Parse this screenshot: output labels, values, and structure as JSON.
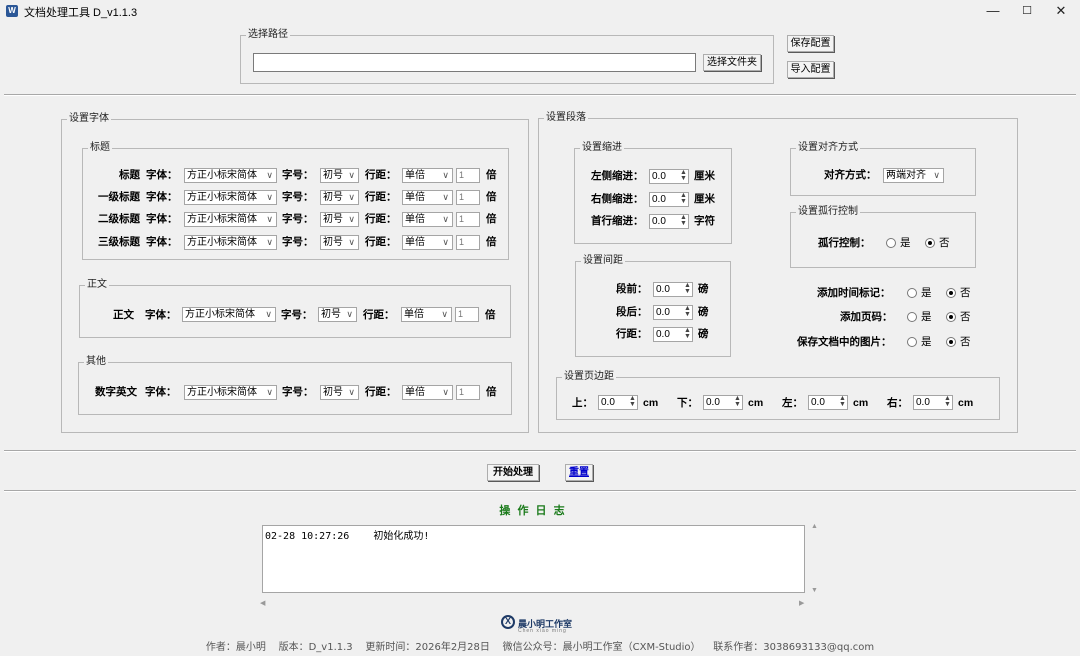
{
  "window": {
    "title": "文档处理工具 D_v1.1.3",
    "icon_letter": "W",
    "minimize": "—",
    "maximize": "☐",
    "close": "✕"
  },
  "path": {
    "group_title": "选择路径",
    "value": "",
    "browse_label": "选择文件夹"
  },
  "config": {
    "save_label": "保存配置",
    "import_label": "导入配置"
  },
  "font": {
    "group_title": "设置字体",
    "heading_group": "标题",
    "body_group": "正文",
    "other_group": "其他",
    "font_label": "字体：",
    "size_label": "字号：",
    "spacing_label": "行距：",
    "times_label": "倍",
    "rows": [
      {
        "name": "标题",
        "font": "方正小标宋简体",
        "size": "初号",
        "spacing": "单倍",
        "value": "1"
      },
      {
        "name": "一级标题",
        "font": "方正小标宋简体",
        "size": "初号",
        "spacing": "单倍",
        "value": "1"
      },
      {
        "name": "二级标题",
        "font": "方正小标宋简体",
        "size": "初号",
        "spacing": "单倍",
        "value": "1"
      },
      {
        "name": "三级标题",
        "font": "方正小标宋简体",
        "size": "初号",
        "spacing": "单倍",
        "value": "1"
      }
    ],
    "body_row": {
      "name": "正文",
      "font": "方正小标宋简体",
      "size": "初号",
      "spacing": "单倍",
      "value": "1"
    },
    "other_row": {
      "name": "数字英文",
      "font": "方正小标宋简体",
      "size": "初号",
      "spacing": "单倍",
      "value": "1"
    }
  },
  "paragraph": {
    "group_title": "设置段落",
    "indent": {
      "title": "设置缩进",
      "left_label": "左侧缩进：",
      "left_value": "0.0",
      "left_unit": "厘米",
      "right_label": "右侧缩进：",
      "right_value": "0.0",
      "right_unit": "厘米",
      "first_label": "首行缩进：",
      "first_value": "0.0",
      "first_unit": "字符"
    },
    "spacing": {
      "title": "设置间距",
      "before_label": "段前：",
      "before_value": "0.0",
      "before_unit": "磅",
      "after_label": "段后：",
      "after_value": "0.0",
      "after_unit": "磅",
      "line_label": "行距：",
      "line_value": "0.0",
      "line_unit": "磅"
    },
    "align": {
      "title": "设置对齐方式",
      "label": "对齐方式：",
      "value": "两端对齐"
    },
    "orphan": {
      "title": "设置孤行控制",
      "label": "孤行控制：",
      "yes": "是",
      "no": "否"
    },
    "timestamp_label": "添加时间标记：",
    "pagenum_label": "添加页码：",
    "keep_images_label": "保存文档中的图片：",
    "yes": "是",
    "no": "否",
    "margins": {
      "title": "设置页边距",
      "top_label": "上：",
      "top_value": "0.0",
      "bottom_label": "下：",
      "bottom_value": "0.0",
      "left_label": "左：",
      "left_value": "0.0",
      "right_label": "右：",
      "right_value": "0.0",
      "unit": "cm"
    }
  },
  "actions": {
    "start_label": "开始处理",
    "reset_label": "重置"
  },
  "log": {
    "title": "操 作 日 志",
    "entries": "02-28 10:27:26    初始化成功!"
  },
  "brand": {
    "name": "晨小明工作室",
    "pinyin": "Chen xiao ming"
  },
  "footer": "作者：晨小明    版本：D_v1.1.3    更新时间：2026年2月28日    微信公众号：晨小明工作室（CXM-Studio）    联系作者：3038693133@qq.com",
  "colors": {
    "log_title": "#1a7a1a",
    "reset_link": "#0000cc",
    "app_icon": "#2b5797"
  }
}
